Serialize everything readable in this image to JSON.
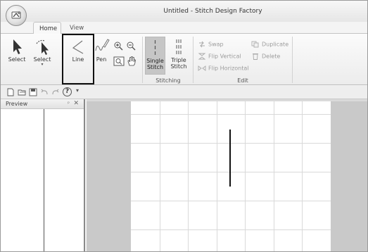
{
  "window": {
    "title": "Untitled - Stitch Design Factory"
  },
  "tabs": [
    {
      "label": "Home",
      "active": true
    },
    {
      "label": "View",
      "active": false
    }
  ],
  "ribbon": {
    "select": {
      "label": "Select",
      "icon": "arrow-cursor-icon"
    },
    "select_dropdown": {
      "label": "Select",
      "icon": "lasso-select-icon"
    },
    "line": {
      "label": "Line",
      "icon": "line-tool-icon",
      "highlighted": true
    },
    "pen": {
      "label": "Pen",
      "icon": "pen-tool-icon"
    },
    "zoom_in": {
      "icon": "zoom-in-icon"
    },
    "zoom_out": {
      "icon": "zoom-out-icon"
    },
    "fit": {
      "icon": "fit-to-window-icon"
    },
    "pan": {
      "icon": "hand-pan-icon"
    },
    "stitching": {
      "label": "Stitching",
      "single": {
        "line1": "Single",
        "line2": "Stitch",
        "selected": true
      },
      "triple": {
        "line1": "Triple",
        "line2": "Stitch",
        "selected": false
      }
    },
    "edit": {
      "label": "Edit",
      "swap": "Swap",
      "flip_vertical": "Flip Vertical",
      "flip_horizontal": "Flip Horizontal",
      "duplicate": "Duplicate",
      "delete": "Delete",
      "enabled": false
    }
  },
  "quick_access": {
    "icons": [
      "new-file-icon",
      "open-folder-icon",
      "save-icon",
      "undo-icon",
      "redo-icon",
      "help-icon",
      "customize-dropdown-icon"
    ],
    "help_glyph": "?",
    "dropdown_glyph": "▾"
  },
  "preview": {
    "title": "Preview",
    "pin_glyph": "ᵖ",
    "close_glyph": "✕"
  },
  "colors": {
    "accent_selected": "#c6c6c6",
    "highlight_border": "#111111",
    "canvas_background": "#c9c9c9",
    "grid_line": "#d9d9d9",
    "stitch_line": "#111111"
  },
  "canvas": {
    "grid_columns": 7,
    "grid_rows": 5,
    "stitch": {
      "kind": "single-stitch line",
      "orientation": "vertical"
    }
  }
}
